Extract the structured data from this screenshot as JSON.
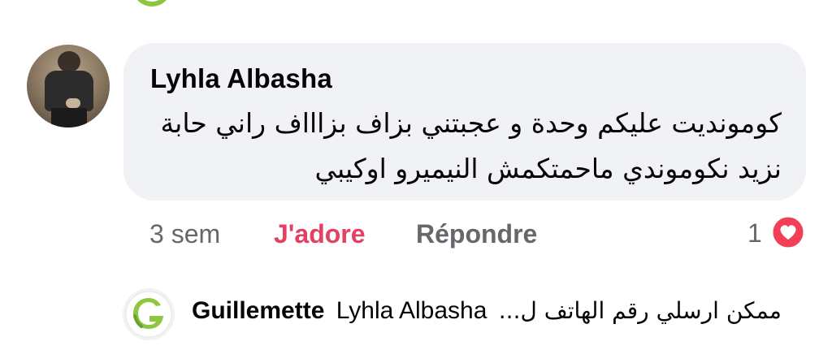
{
  "comment": {
    "author": "Lyhla Albasha",
    "text": "كوموнديت عليكم وحدة و عجبتني بزاف بزاااف راني حابة نزيد نكوموندي ماحمتكمش النيميرو اوكيبي",
    "time": "3 sem",
    "like_label": "J'adore",
    "reply_label": "Répondre",
    "reaction_count": "1"
  },
  "reply": {
    "author": "Guillemette",
    "mention": "Lyhla Albasha",
    "preview": "ممكن ارسلي رقم الهاتف ل..."
  },
  "colors": {
    "bubble": "#f0f2f5",
    "like": "#e4405f",
    "muted": "#65676b",
    "brand_green": "#8dc63f"
  },
  "icons": {
    "reaction": "heart-icon",
    "reply_avatar": "guillemette-logo"
  }
}
